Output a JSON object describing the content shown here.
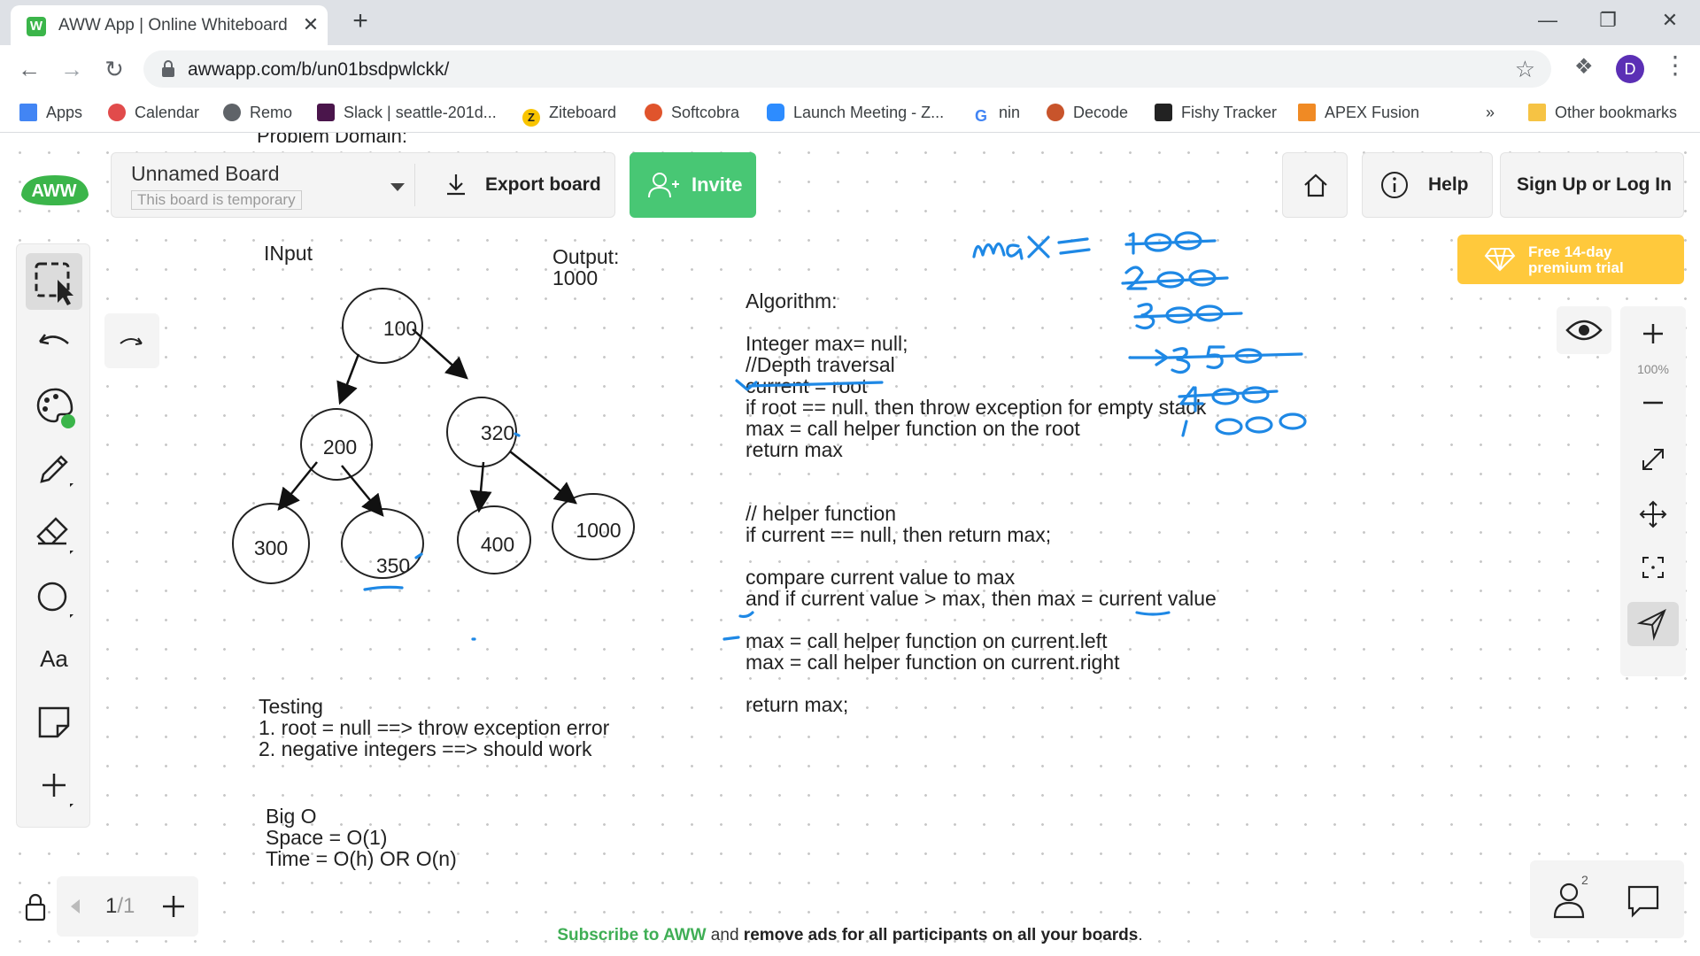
{
  "browser": {
    "tab_title": "AWW App | Online Whiteboard for",
    "tab_favicon": "W",
    "tab_close": "✕",
    "new_tab": "+",
    "url": "awwapp.com/b/un01bsdpwlckk/",
    "profile_initial": "D",
    "bookmarks": [
      {
        "label": "Apps",
        "icon": "apps-grid-icon",
        "color": "#4285f4"
      },
      {
        "label": "Calendar",
        "icon": "calendar-icon",
        "color": "#e14b4b"
      },
      {
        "label": "Remo",
        "icon": "globe-icon",
        "color": "#5f6368"
      },
      {
        "label": "Slack | seattle-201d...",
        "icon": "slack-icon",
        "color": "#4a154b"
      },
      {
        "label": "Ziteboard",
        "icon": "ziteboard-icon",
        "color": "#f9c400"
      },
      {
        "label": "Softcobra",
        "icon": "softcobra-icon",
        "color": "#e0542c"
      },
      {
        "label": "Launch Meeting - Z...",
        "icon": "zoom-icon",
        "color": "#2d8cff"
      },
      {
        "label": "nin",
        "icon": "google-icon",
        "color": "#4285f4"
      },
      {
        "label": "Decode",
        "icon": "decode-icon",
        "color": "#c8542b"
      },
      {
        "label": "Fishy Tracker",
        "icon": "fishy-icon",
        "color": "#222222"
      },
      {
        "label": "APEX Fusion",
        "icon": "apex-icon",
        "color": "#f08a24"
      }
    ],
    "overflow": "»",
    "other_bookmarks": "Other bookmarks"
  },
  "app": {
    "board_title_partial": "Problem Domain:",
    "board_name": "Unnamed Board",
    "board_badge": "This board is temporary",
    "export_label": "Export board",
    "invite_label": "Invite",
    "help_label": "Help",
    "signup_label": "Sign Up or Log In",
    "trial_line1": "Free 14-day",
    "trial_line2": "premium trial",
    "zoom_level": "100%",
    "text_tool": "Aa",
    "page_current": "1",
    "page_total": "/1",
    "participants": "2",
    "promo_link": "Subscribe to AWW",
    "promo_mid": " and ",
    "promo_rest": "remove ads for all participants on all your boards",
    "promo_end": "."
  },
  "board": {
    "input_label": "INput",
    "output_label": "Output:",
    "output_value": "1000",
    "tree_nodes": [
      "100",
      "200",
      "320",
      "300",
      "350",
      "400",
      "1000"
    ],
    "algorithm": [
      "Algorithm:",
      "",
      "Integer max= null;",
      "//Depth traversal",
      "current = root",
      "if root == null. then throw exception for empty stack",
      "max = call helper function on the root",
      "return max",
      "",
      "",
      "// helper function",
      "if current == null, then return max;",
      "",
      "compare current value to max",
      "and if current value > max, then max = current value",
      "",
      "max = call helper function on current.left",
      "max = call helper function on current.right",
      "",
      "return max;"
    ],
    "testing": [
      "Testing",
      "1. root = null ==> throw exception error",
      "2. negative integers ==> should work"
    ],
    "bigo": [
      "Big O",
      "Space = O(1)",
      "Time = O(h) OR O(n)"
    ]
  },
  "colors": {
    "accent_green": "#48c774",
    "trial_yellow": "#ffc93c",
    "ink_blue": "#1e88e5",
    "logo_green": "#3bb54a"
  }
}
